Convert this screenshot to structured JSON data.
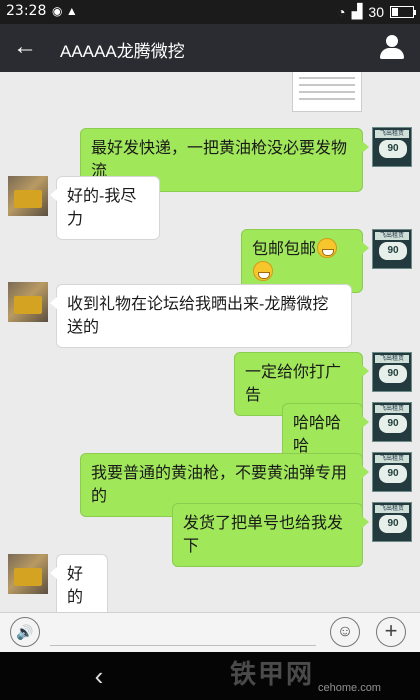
{
  "status_bar": {
    "time": "23:28",
    "notification_icons": [
      "eye-icon",
      "profile-icon"
    ],
    "signal_icons": [
      "wifi-icon",
      "signal-icon"
    ],
    "battery_level": 30,
    "battery_text": "30"
  },
  "header": {
    "back_icon": "‹",
    "title": "AAAAA龙腾微挖",
    "profile_icon": "person-icon"
  },
  "messages": [
    {
      "side": "out",
      "text": "最好发快递，一把黄油枪没必要发物流"
    },
    {
      "side": "in",
      "text": "好的-我尽力"
    },
    {
      "side": "out",
      "text": "包邮包邮",
      "emoji_count": 2
    },
    {
      "side": "in",
      "text": "收到礼物在论坛给我晒出来-龙腾微挖送的"
    },
    {
      "side": "out",
      "text": "一定给你打广告"
    },
    {
      "side": "out",
      "text": "哈哈哈哈"
    },
    {
      "side": "out",
      "text": "我要普通的黄油枪，不要黄油弹专用的"
    },
    {
      "side": "out",
      "text": "发货了把单号也给我发下"
    },
    {
      "side": "in",
      "text": "好的"
    }
  ],
  "avatar_right": {
    "top_text": "飞出租赁",
    "badge_text": "90"
  },
  "input_bar": {
    "voice_icon": "🔊",
    "text_value": "",
    "emoji_icon": "☺",
    "plus_icon": "+"
  },
  "nav_bar": {
    "back_icon": "‹",
    "watermark": "铁甲网",
    "watermark_url": "cehome.com"
  },
  "colors": {
    "outgoing_bubble": "#a0e75a",
    "incoming_bubble": "#ffffff",
    "header_bg": "#2a2c31",
    "chat_bg": "#ebebeb"
  }
}
